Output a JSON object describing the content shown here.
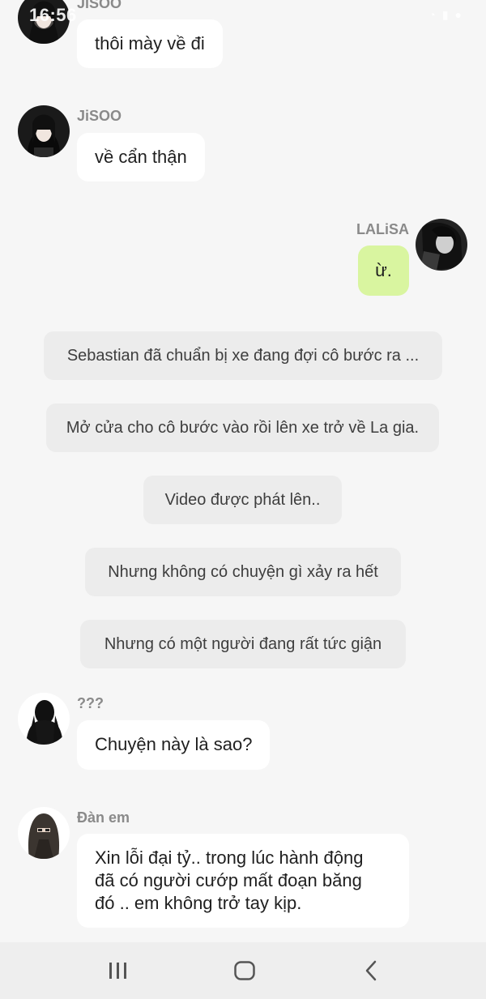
{
  "status": {
    "time": "16:56"
  },
  "messages": [
    {
      "sender": "JiSOO",
      "text": "thôi mày về đi",
      "avatar": "jisoo-avatar"
    },
    {
      "sender": "JiSOO",
      "text": "về cẩn thận",
      "avatar": "jisoo-avatar"
    },
    {
      "sender": "LALiSA",
      "text": "ừ.",
      "avatar": "lalisa-avatar",
      "mine": true
    }
  ],
  "narrations": [
    "Sebastian đã chuẩn bị xe đang đợi cô bước ra ...",
    "Mở cửa cho cô bước vào rồi lên xe trở về La gia.",
    "Video được phát lên..",
    "Nhưng không có chuyện gì xảy ra hết",
    "Nhưng có một người đang rất tức giận"
  ],
  "later_messages": [
    {
      "sender": "???",
      "text": "Chuyện này là sao?",
      "avatar": "silhouette-avatar"
    },
    {
      "sender": "Đàn em",
      "text_lines": [
        "Xin lỗi đại tỷ.. trong lúc hành động",
        "đã có người cướp mất đoạn băng",
        "đó .. em không trở tay kịp."
      ],
      "avatar": "masked-avatar"
    }
  ],
  "navbar": {
    "icons": [
      "recents-icon",
      "home-icon",
      "back-icon"
    ]
  },
  "colors": {
    "background": "#f6f6f6",
    "bubble": "#ffffff",
    "my_bubble": "#d9f5a0",
    "narration": "#ececec",
    "sender_name": "#8a8a8a"
  }
}
